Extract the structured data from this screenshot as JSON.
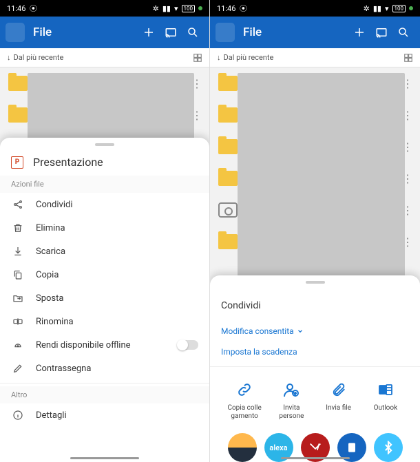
{
  "status": {
    "time": "11:46",
    "battery": "100"
  },
  "appbar": {
    "title": "File"
  },
  "sort": {
    "label": "Dal più recente"
  },
  "sheet_left": {
    "file_name": "Presentazione",
    "section_actions": "Azioni file",
    "section_other": "Altro",
    "items": {
      "share": "Condividi",
      "delete": "Elimina",
      "download": "Scarica",
      "copy": "Copia",
      "move": "Sposta",
      "rename": "Rinomina",
      "offline": "Rendi disponibile offline",
      "mark": "Contrassegna",
      "details": "Dettagli"
    }
  },
  "sheet_right": {
    "title": "Condividi",
    "edit_permission": "Modifica consentita",
    "set_expiry": "Imposta la scadenza",
    "actions": {
      "copy_link": "Copia colle gamento",
      "invite": "Invita persone",
      "send_file": "Invia file",
      "outlook": "Outlook"
    },
    "apps": {
      "alexa": "alexa"
    }
  }
}
